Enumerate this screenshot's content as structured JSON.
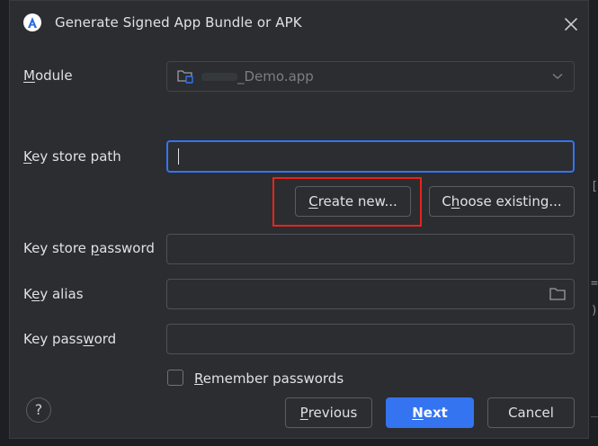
{
  "dialog": {
    "title": "Generate Signed App Bundle or APK",
    "app_icon": "android-studio-icon",
    "close_icon": "close-icon"
  },
  "module": {
    "label_prefix": "M",
    "label_rest": "odule",
    "value": "_Demo.app",
    "icon": "module-folder-icon",
    "dropdown_icon": "chevron-down-icon"
  },
  "keystore_path": {
    "label_prefix": "K",
    "label_rest": "ey store path",
    "value": ""
  },
  "buttons": {
    "create_new": {
      "underline": "C",
      "rest": "reate new..."
    },
    "choose_existing": {
      "before": "C",
      "underline": "h",
      "rest": "oose existing..."
    },
    "previous": {
      "underline": "P",
      "rest": "revious"
    },
    "next": {
      "underline": "N",
      "rest": "ext"
    },
    "cancel": "Cancel"
  },
  "keystore_password": {
    "label_before": "Key store ",
    "label_underline": "p",
    "label_rest": "assword",
    "value": ""
  },
  "key_alias": {
    "label_before": "K",
    "label_underline": "e",
    "label_rest": "y alias",
    "value": "",
    "browse_icon": "folder-icon"
  },
  "key_password": {
    "label_before": "Key pass",
    "label_underline": "w",
    "label_rest": "ord",
    "value": ""
  },
  "remember": {
    "underline": "R",
    "rest": "emember passwords",
    "checked": false
  },
  "help": {
    "glyph": "?",
    "icon": "help-icon"
  },
  "colors": {
    "accent": "#3574f0",
    "highlight": "#e8241c",
    "dialog_bg": "#2b2d30",
    "text": "#dfe1e5"
  }
}
